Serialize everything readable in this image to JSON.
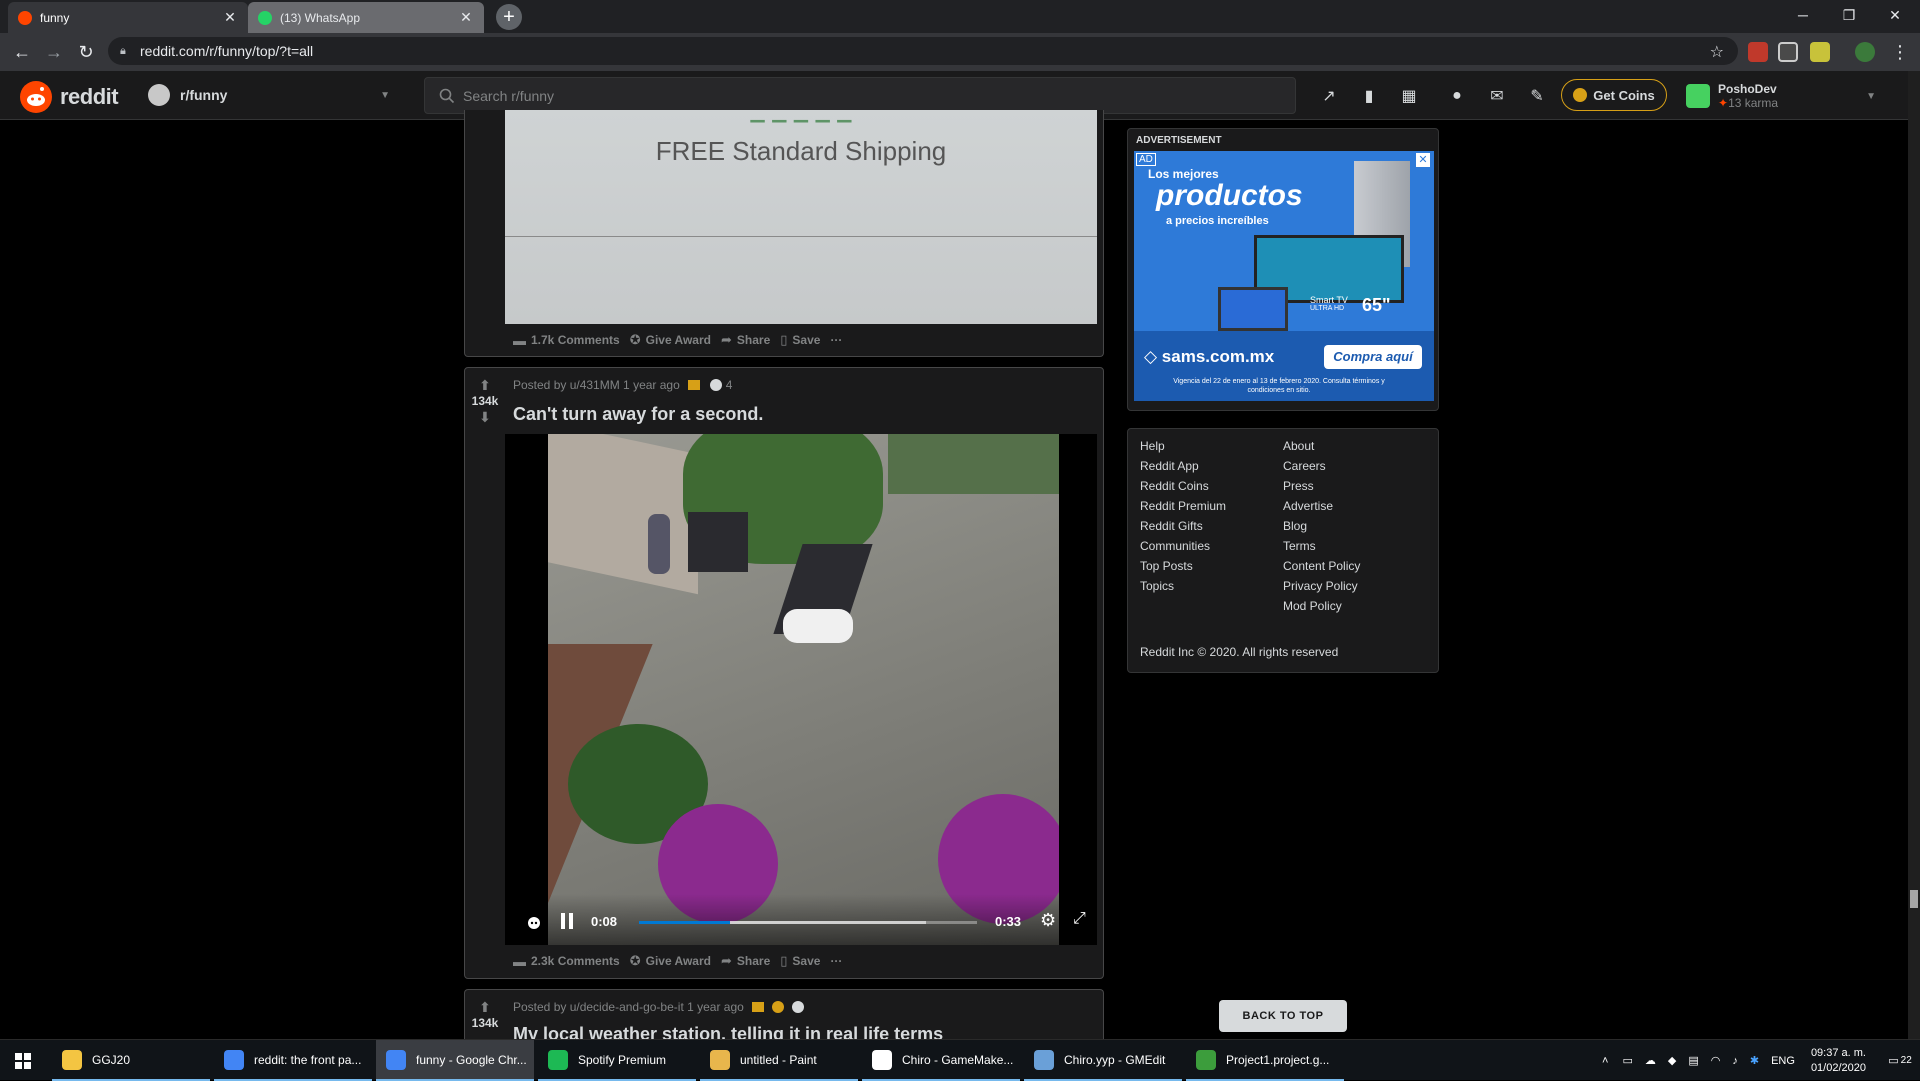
{
  "browser": {
    "tabs": [
      {
        "label": "funny",
        "active": true
      },
      {
        "label": "(13) WhatsApp",
        "active": false
      }
    ],
    "new_tab": "+",
    "url": "reddit.com/r/funny/top/?t=all",
    "window_controls": {
      "minimize": "─",
      "restore": "❐",
      "close": "✕"
    }
  },
  "reddit_header": {
    "logo_text": "reddit",
    "subreddit": "r/funny",
    "search_placeholder": "Search r/funny",
    "get_coins": "Get Coins",
    "username": "PoshoDev",
    "karma": "13 karma"
  },
  "post_prev": {
    "image_text": "FREE Standard Shipping",
    "comments": "1.7k Comments",
    "give_award": "Give Award",
    "share": "Share",
    "save": "Save",
    "more": "···"
  },
  "post_main": {
    "votes": "134k",
    "posted_by": "Posted by u/431MM 1 year ago",
    "award_count": "4",
    "title": "Can't turn away for a second.",
    "video": {
      "current_time": "0:08",
      "duration": "0:33",
      "progress": 0.27,
      "buffered": 0.85
    },
    "comments": "2.3k Comments",
    "give_award": "Give Award",
    "share": "Share",
    "save": "Save",
    "more": "···"
  },
  "post_next": {
    "votes": "134k",
    "posted_by": "Posted by u/decide-and-go-be-it 1 year ago",
    "title": "My local weather station, telling it in real life terms"
  },
  "sidebar": {
    "ad_label": "ADVERTISEMENT",
    "ad": {
      "badge": "AD",
      "line1": "Los mejores",
      "line2": "productos",
      "line3": "a precios increíbles",
      "tv_label": "Smart TV",
      "tv_sub": "ULTRA HD",
      "tv_size": "65\"",
      "domain": "sams.com.mx",
      "cta": "Compra aquí",
      "fine_print": "Vigencia del 22 de enero al 13 de febrero 2020. Consulta términos y condiciones en sitio."
    },
    "links_left": [
      "Help",
      "Reddit App",
      "Reddit Coins",
      "Reddit Premium",
      "Reddit Gifts",
      "Communities",
      "Top Posts",
      "Topics"
    ],
    "links_right": [
      "About",
      "Careers",
      "Press",
      "Advertise",
      "Blog",
      "Terms",
      "Content Policy",
      "Privacy Policy",
      "Mod Policy"
    ],
    "copyright": "Reddit Inc © 2020. All rights reserved",
    "back_to_top": "BACK TO TOP"
  },
  "taskbar": {
    "items": [
      {
        "label": "GGJ20",
        "icon": "folder-icon",
        "color": "#f4c542"
      },
      {
        "label": "reddit: the front pa...",
        "icon": "chrome-icon",
        "color": "#4285f4"
      },
      {
        "label": "funny - Google Chr...",
        "icon": "chrome-icon",
        "color": "#4285f4"
      },
      {
        "label": "Spotify Premium",
        "icon": "spotify-icon",
        "color": "#1db954"
      },
      {
        "label": "untitled - Paint",
        "icon": "paint-icon",
        "color": "#e8b64c"
      },
      {
        "label": "Chiro - GameMake...",
        "icon": "gamemaker-icon",
        "color": "#ffffff"
      },
      {
        "label": "Chiro.yyp - GMEdit",
        "icon": "gmedit-icon",
        "color": "#6aa0d8"
      },
      {
        "label": "Project1.project.g...",
        "icon": "project-icon",
        "color": "#3c9d3c"
      }
    ],
    "language": "ENG",
    "time": "09:37 a. m.",
    "date": "01/02/2020",
    "notifications": "22"
  },
  "colors": {
    "reddit_orange": "#ff4500",
    "card_bg": "#1a1a1b",
    "text": "#d7dadc",
    "muted": "#818384",
    "coin_gold": "#d7a017"
  }
}
